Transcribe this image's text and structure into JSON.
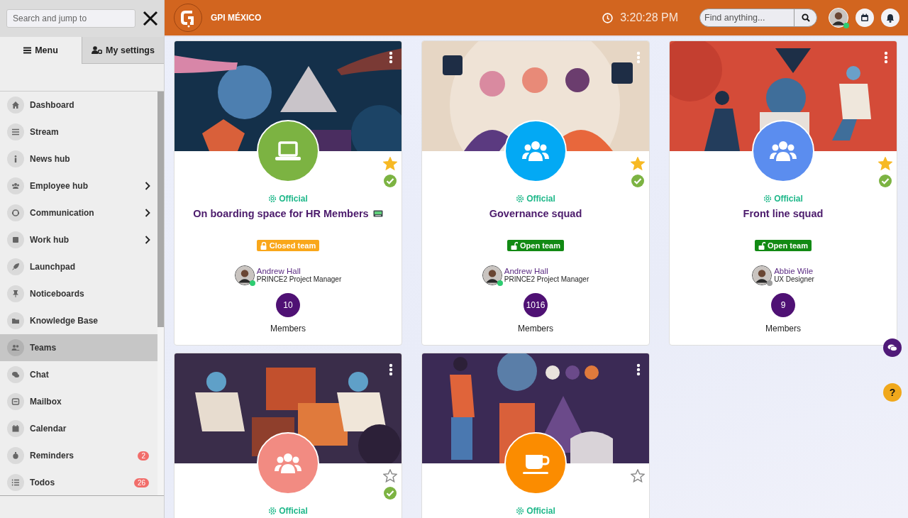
{
  "sidebar": {
    "search": {
      "placeholder": "Search and jump to"
    },
    "tabs": [
      {
        "label": "Menu",
        "selected": true
      },
      {
        "label": "My settings",
        "selected": false
      }
    ],
    "items": [
      {
        "label": "Dashboard",
        "selected": false,
        "expandable": false
      },
      {
        "label": "Stream",
        "selected": false,
        "expandable": false
      },
      {
        "label": "News hub",
        "selected": false,
        "expandable": false
      },
      {
        "label": "Employee hub",
        "selected": false,
        "expandable": true
      },
      {
        "label": "Communication",
        "selected": false,
        "expandable": true
      },
      {
        "label": "Work hub",
        "selected": false,
        "expandable": true
      },
      {
        "label": "Launchpad",
        "selected": false,
        "expandable": false
      },
      {
        "label": "Noticeboards",
        "selected": false,
        "expandable": false
      },
      {
        "label": "Knowledge Base",
        "selected": false,
        "expandable": false
      },
      {
        "label": "Teams",
        "selected": true,
        "expandable": false
      },
      {
        "label": "Chat",
        "selected": false,
        "expandable": false
      },
      {
        "label": "Mailbox",
        "selected": false,
        "expandable": false
      },
      {
        "label": "Calendar",
        "selected": false,
        "expandable": false
      },
      {
        "label": "Reminders",
        "selected": false,
        "expandable": false,
        "badge": "2"
      },
      {
        "label": "Todos",
        "selected": false,
        "expandable": false,
        "badge": "26"
      }
    ]
  },
  "topbar": {
    "brand": "GPI MÉXICO",
    "time": "3:20:28 PM",
    "search": {
      "placeholder": "Find anything..."
    },
    "user": {
      "online": true
    }
  },
  "teams": [
    {
      "kind": "laptop",
      "color": "#7cb342",
      "starred": true,
      "verified": true,
      "official": "Official",
      "title": "On boarding space for HR Members",
      "title_icon": true,
      "privacy": {
        "kind": "closed",
        "label": "Closed team"
      },
      "owner": {
        "name": "Andrew Hall",
        "role": "PRINCE2 Project Manager",
        "online": true
      },
      "members": "10",
      "members_label": "Members"
    },
    {
      "kind": "group",
      "color": "#03a9f4",
      "starred": true,
      "verified": true,
      "official": "Official",
      "title": "Governance squad",
      "title_icon": false,
      "privacy": {
        "kind": "open",
        "label": "Open team"
      },
      "owner": {
        "name": "Andrew Hall",
        "role": "PRINCE2 Project Manager",
        "online": true
      },
      "members": "1016",
      "members_label": "Members"
    },
    {
      "kind": "group",
      "color": "#5b8def",
      "starred": true,
      "verified": true,
      "official": "Official",
      "title": "Front line squad",
      "title_icon": false,
      "privacy": {
        "kind": "open",
        "label": "Open team"
      },
      "owner": {
        "name": "Abbie Wile",
        "role": "UX Designer",
        "online": false
      },
      "members": "9",
      "members_label": "Members"
    },
    {
      "kind": "group",
      "color": "#f28b82",
      "starred": false,
      "verified": true,
      "official": "Official"
    },
    {
      "kind": "coffee",
      "color": "#fb8c00",
      "starred": false,
      "verified": false,
      "official": "Official"
    }
  ],
  "help": {
    "label": "?"
  }
}
